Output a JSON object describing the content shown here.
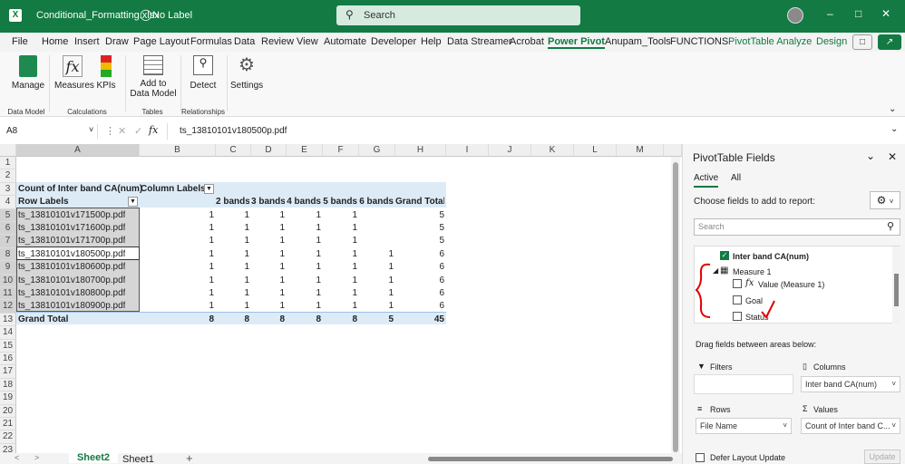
{
  "titlebar": {
    "filename": "Conditional_Formatting.xlsx",
    "sensitivity": "No Label",
    "search_placeholder": "Search"
  },
  "menu": [
    "File",
    "Home",
    "Insert",
    "Draw",
    "Page Layout",
    "Formulas",
    "Data",
    "Review",
    "View",
    "Automate",
    "Developer",
    "Help",
    "Data Streamer",
    "Acrobat",
    "Power Pivot",
    "Anupam_Tools",
    "FUNCTIONS",
    "PivotTable Analyze",
    "Design"
  ],
  "ribbon": {
    "manage": "Manage",
    "measures": "Measures",
    "kpis": "KPIs",
    "add_to_data_model": "Add to\nData Model",
    "detect": "Detect",
    "settings": "Settings",
    "groups": {
      "data_model": "Data Model",
      "calculations": "Calculations",
      "tables": "Tables",
      "relationships": "Relationships"
    }
  },
  "formula": {
    "name_box": "A8",
    "fx": "fx",
    "value": "ts_13810101v180500p.pdf"
  },
  "columns": [
    "A",
    "B",
    "C",
    "D",
    "E",
    "F",
    "G",
    "H",
    "I",
    "J",
    "K",
    "L",
    "M"
  ],
  "rows": [
    "1",
    "2",
    "3",
    "4",
    "5",
    "6",
    "7",
    "8",
    "9",
    "10",
    "11",
    "12",
    "13",
    "14",
    "15",
    "16",
    "17",
    "18",
    "19",
    "20",
    "21",
    "22",
    "23"
  ],
  "pivot": {
    "title": "Count of Inter band CA(num)",
    "column_labels": "Column Labels",
    "row_labels": "Row Labels",
    "headers": [
      "2 bands",
      "3 bands",
      "4 bands",
      "5 bands",
      "6 bands",
      "Grand Total"
    ],
    "data": [
      {
        "label": "ts_13810101v171500p.pdf",
        "v": [
          "1",
          "1",
          "1",
          "1",
          "1",
          "",
          "5"
        ]
      },
      {
        "label": "ts_13810101v171600p.pdf",
        "v": [
          "1",
          "1",
          "1",
          "1",
          "1",
          "",
          "5"
        ]
      },
      {
        "label": "ts_13810101v171700p.pdf",
        "v": [
          "1",
          "1",
          "1",
          "1",
          "1",
          "",
          "5"
        ]
      },
      {
        "label": "ts_13810101v180500p.pdf",
        "v": [
          "1",
          "1",
          "1",
          "1",
          "1",
          "1",
          "6"
        ]
      },
      {
        "label": "ts_13810101v180600p.pdf",
        "v": [
          "1",
          "1",
          "1",
          "1",
          "1",
          "1",
          "6"
        ]
      },
      {
        "label": "ts_13810101v180700p.pdf",
        "v": [
          "1",
          "1",
          "1",
          "1",
          "1",
          "1",
          "6"
        ]
      },
      {
        "label": "ts_13810101v180800p.pdf",
        "v": [
          "1",
          "1",
          "1",
          "1",
          "1",
          "1",
          "6"
        ]
      },
      {
        "label": "ts_13810101v180900p.pdf",
        "v": [
          "1",
          "1",
          "1",
          "1",
          "1",
          "1",
          "6"
        ]
      }
    ],
    "grand_total": {
      "label": "Grand Total",
      "v": [
        "8",
        "8",
        "8",
        "8",
        "8",
        "5",
        "45"
      ]
    }
  },
  "sheets": {
    "active": "Sheet2",
    "other": "Sheet1",
    "add": "+"
  },
  "pane": {
    "title": "PivotTable Fields",
    "tab_active": "Active",
    "tab_all": "All",
    "choose": "Choose fields to add to report:",
    "search_placeholder": "Search",
    "fields": [
      {
        "name": "Inter band CA(num)",
        "checked": true
      },
      {
        "name": "Measure 1"
      },
      {
        "name": "Value (Measure 1)",
        "checked": false
      },
      {
        "name": "Goal",
        "checked": false
      },
      {
        "name": "Status",
        "checked": false
      }
    ],
    "drag_text": "Drag fields between areas below:",
    "filters": "Filters",
    "columns": "Columns",
    "columns_value": "Inter band CA(num)",
    "rows": "Rows",
    "rows_value": "File Name",
    "values": "Values",
    "values_value": "Count of Inter band C...",
    "defer": "Defer Layout Update",
    "update": "Update"
  },
  "colors": {
    "excel_green": "#137a43",
    "pivot_header": "#ddebf7",
    "selection": "#d6d6d6",
    "annotation_red": "#e00000"
  }
}
